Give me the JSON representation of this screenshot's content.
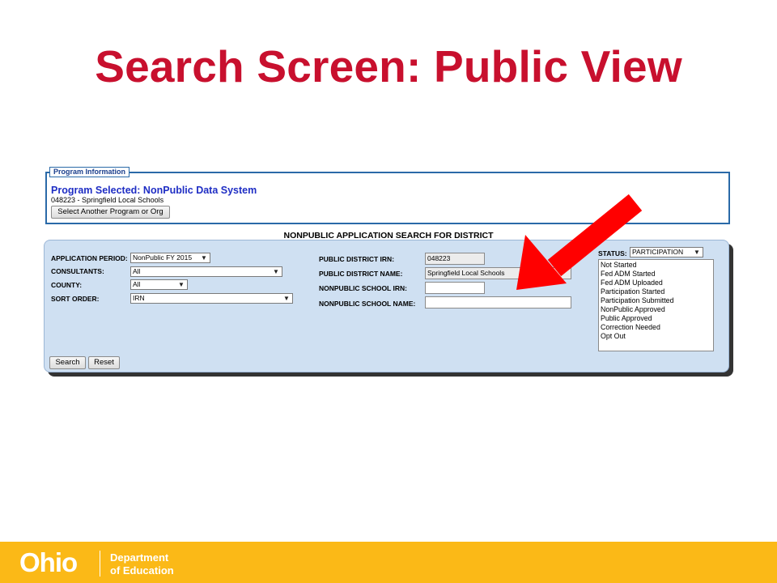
{
  "slide": {
    "title": "Search Screen: Public View"
  },
  "program_info": {
    "legend": "Program Information",
    "selected": "Program Selected: NonPublic Data System",
    "district": "048223 - Springfield Local Schools",
    "change_button": "Select Another Program or Org"
  },
  "search": {
    "heading": "NONPUBLIC APPLICATION SEARCH FOR DISTRICT",
    "application_period": {
      "label": "APPLICATION PERIOD:",
      "value": "NonPublic FY 2015"
    },
    "consultants": {
      "label": "CONSULTANTS:",
      "value": "All"
    },
    "county": {
      "label": "COUNTY:",
      "value": "All"
    },
    "sort_order": {
      "label": "SORT ORDER:",
      "value": "IRN"
    },
    "public_district_irn": {
      "label": "PUBLIC DISTRICT IRN:",
      "value": "048223"
    },
    "public_district_name": {
      "label": "PUBLIC DISTRICT NAME:",
      "value": "Springfield Local Schools"
    },
    "nonpublic_school_irn": {
      "label": "NONPUBLIC SCHOOL IRN:",
      "value": ""
    },
    "nonpublic_school_name": {
      "label": "NONPUBLIC SCHOOL NAME:",
      "value": ""
    },
    "status": {
      "label": "STATUS:",
      "value": "PARTICIPATION",
      "options": [
        "Not Started",
        "Fed ADM Started",
        "Fed ADM Uploaded",
        "Participation Started",
        "Participation Submitted",
        "NonPublic Approved",
        "Public Approved",
        "Correction Needed",
        "Opt Out"
      ]
    },
    "search_button": "Search",
    "reset_button": "Reset"
  },
  "footer": {
    "logo": "Ohio",
    "dept_line1": "Department",
    "dept_line2": "of Education"
  },
  "colors": {
    "title": "#c8102e",
    "panel": "#cfe0f2",
    "footer": "#fbb917",
    "arrow": "#ff0000",
    "program_text": "#1f2ec4"
  }
}
